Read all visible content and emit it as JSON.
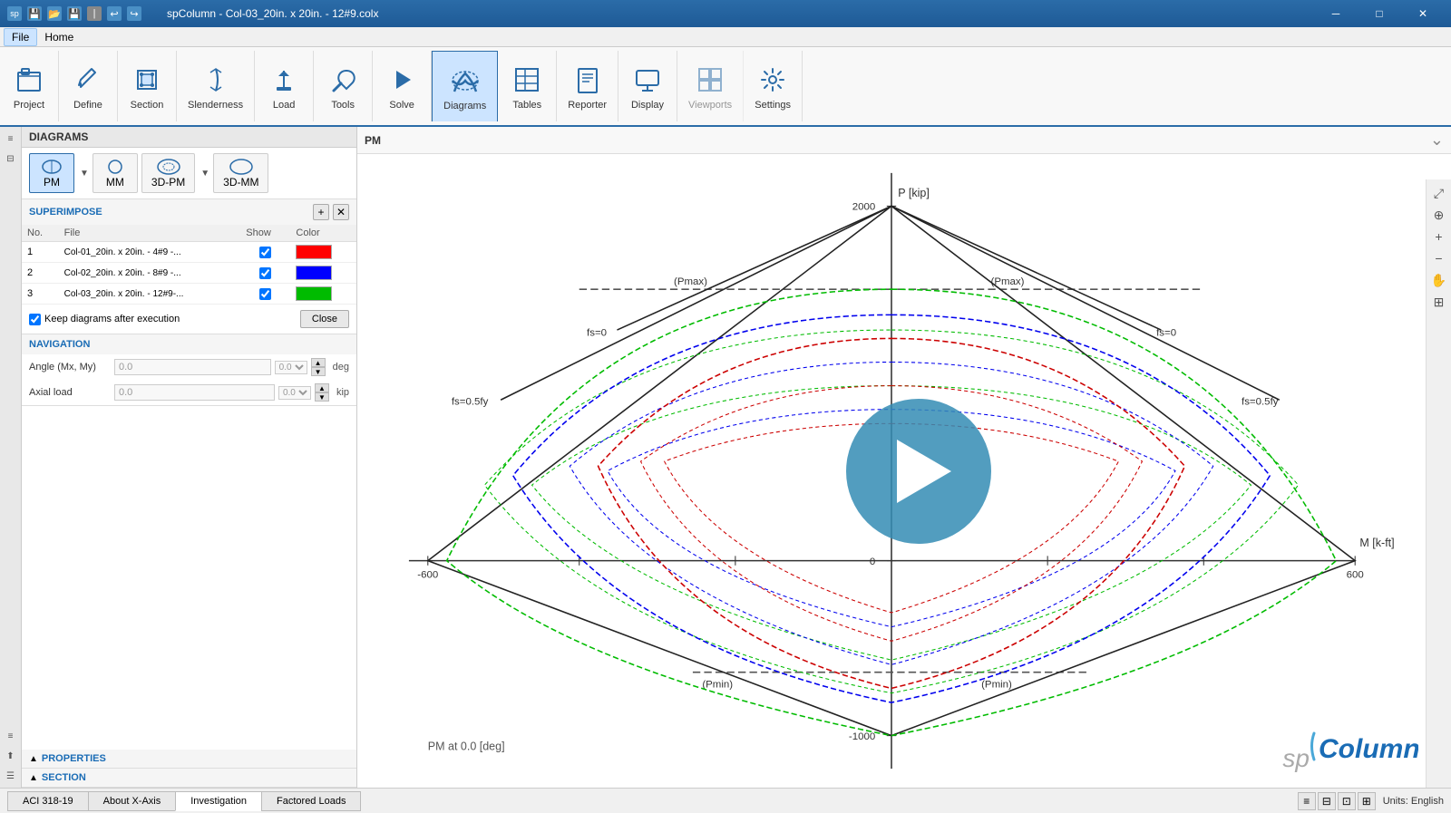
{
  "titleBar": {
    "title": "spColumn - Col-03_20in. x 20in. - 12#9.colx",
    "minimize": "─",
    "maximize": "□",
    "close": "✕",
    "appIcon": "sp"
  },
  "menuBar": {
    "items": [
      "File",
      "Home"
    ]
  },
  "ribbon": {
    "groups": [
      {
        "id": "project",
        "icon": "📁",
        "label": "Project"
      },
      {
        "id": "define",
        "icon": "✏️",
        "label": "Define"
      },
      {
        "id": "section",
        "icon": "⊞",
        "label": "Section"
      },
      {
        "id": "slenderness",
        "icon": "📐",
        "label": "Slenderness"
      },
      {
        "id": "load",
        "icon": "⬇",
        "label": "Load"
      },
      {
        "id": "tools",
        "icon": "🔧",
        "label": "Tools"
      },
      {
        "id": "solve",
        "icon": "▶",
        "label": "Solve"
      },
      {
        "id": "diagrams",
        "icon": "📊",
        "label": "Diagrams",
        "active": true
      },
      {
        "id": "tables",
        "icon": "📋",
        "label": "Tables"
      },
      {
        "id": "reporter",
        "icon": "📄",
        "label": "Reporter"
      },
      {
        "id": "display",
        "icon": "🖥",
        "label": "Display"
      },
      {
        "id": "viewports",
        "icon": "⊟",
        "label": "Viewports"
      },
      {
        "id": "settings",
        "icon": "⚙",
        "label": "Settings"
      }
    ]
  },
  "leftPanel": {
    "header": "DIAGRAMS",
    "diagramTabs": [
      {
        "id": "pm",
        "label": "PM",
        "active": true
      },
      {
        "id": "mm",
        "label": "MM"
      },
      {
        "id": "3d-pm",
        "label": "3D-PM"
      },
      {
        "id": "3d-mm",
        "label": "3D-MM"
      }
    ],
    "superimpose": {
      "title": "SUPERIMPOSE",
      "columns": [
        "No.",
        "File",
        "Show",
        "Color"
      ],
      "rows": [
        {
          "no": "1",
          "file": "Col-01_20in. x 20in. - 4#9 -...",
          "show": true,
          "colorClass": "color-red"
        },
        {
          "no": "2",
          "file": "Col-02_20in. x 20in. - 8#9 -...",
          "show": true,
          "colorClass": "color-blue"
        },
        {
          "no": "3",
          "file": "Col-03_20in. x 20in. - 12#9-...",
          "show": true,
          "colorClass": "color-green"
        }
      ],
      "keepDiagrams": "Keep diagrams after execution",
      "closeBtn": "Close"
    },
    "navigation": {
      "title": "NAVIGATION",
      "angleMx": {
        "label": "Angle (Mx, My)",
        "value": "0.0",
        "unit": "deg"
      },
      "axialLoad": {
        "label": "Axial load",
        "value": "0.0",
        "unit": "kip"
      }
    },
    "properties": {
      "title": "PROPERTIES"
    },
    "section": {
      "title": "SECTION"
    }
  },
  "diagram": {
    "title": "PM",
    "subtitle": "PM at 0.0 [deg]",
    "yAxisLabel": "P [kip]",
    "xAxisLabel": "M [k-ft]",
    "yMax": "2000",
    "yMin": "-1000",
    "xMin": "-600",
    "xMax": "600",
    "pmaxLabel": "(Pmax)",
    "pminLabel": "(Pmin)",
    "fs0Label": "fs=0",
    "fs05fyLabel": "fs=0.5fy",
    "spColumnLogo": "spColumn"
  },
  "statusBar": {
    "tabs": [
      "ACI 318-19",
      "About X-Axis",
      "Investigation",
      "Factored Loads"
    ],
    "activeTab": "Investigation",
    "units": "Units: English"
  }
}
